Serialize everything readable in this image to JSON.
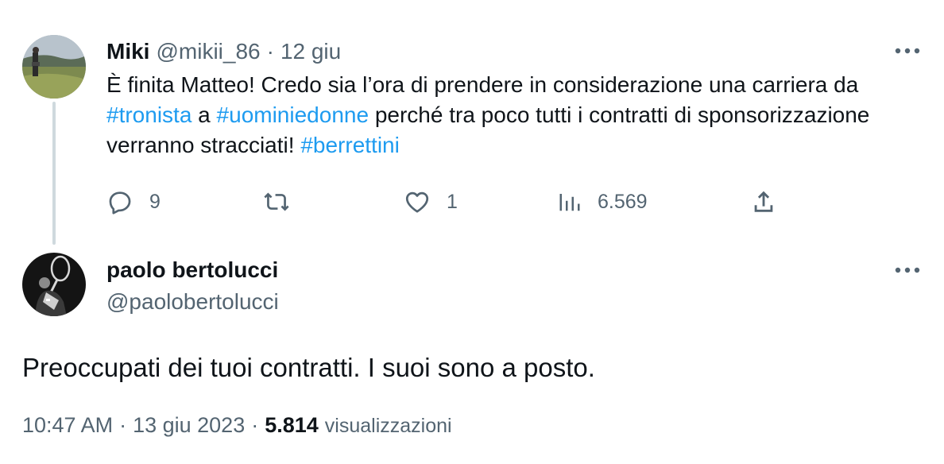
{
  "quoted_tweet": {
    "author_name": "Miki",
    "author_handle": "@mikii_86",
    "separator": "·",
    "date": "12 giu",
    "body": {
      "text_1": "È finita Matteo! Credo sia l’ora di prendere in considerazione una carriera da ",
      "hashtag_1": "#tronista",
      "text_2": " a ",
      "hashtag_2": "#uominiedonne",
      "text_3": " perché tra poco tutti i contratti di sponsorizzazione verranno stracciati!  ",
      "hashtag_3": "#berrettini"
    },
    "actions": {
      "replies": "9",
      "retweets": "",
      "likes": "1",
      "views": "6.569"
    }
  },
  "reply_tweet": {
    "author_name": "paolo bertolucci",
    "author_handle": "@paolobertolucci",
    "body": "Preoccupati dei tuoi contratti. I suoi sono a posto.",
    "meta": {
      "time": "10:47 AM",
      "separator": "·",
      "date": "13 giu 2023",
      "views_count": "5.814",
      "views_label": "visualizzazioni"
    }
  },
  "icons": {
    "more": "more-dots-icon",
    "reply": "reply-bubble-icon",
    "retweet": "retweet-arrows-icon",
    "like": "heart-outline-icon",
    "views": "bar-chart-icon",
    "share": "share-upload-icon"
  },
  "colors": {
    "text": "#0f1419",
    "muted": "#536471",
    "link": "#1d9bf0",
    "thread_line": "#cfd9de"
  }
}
